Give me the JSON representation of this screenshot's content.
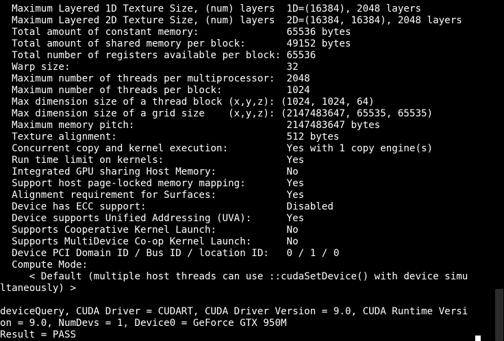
{
  "terminal": {
    "lines": [
      "  Maximum Layered 1D Texture Size, (num) layers  1D=(16384), 2048 layers",
      "  Maximum Layered 2D Texture Size, (num) layers  2D=(16384, 16384), 2048 layers",
      "  Total amount of constant memory:               65536 bytes",
      "  Total amount of shared memory per block:       49152 bytes",
      "  Total number of registers available per block: 65536",
      "  Warp size:                                     32",
      "  Maximum number of threads per multiprocessor:  2048",
      "  Maximum number of threads per block:           1024",
      "  Max dimension size of a thread block (x,y,z): (1024, 1024, 64)",
      "  Max dimension size of a grid size    (x,y,z): (2147483647, 65535, 65535)",
      "  Maximum memory pitch:                          2147483647 bytes",
      "  Texture alignment:                             512 bytes",
      "  Concurrent copy and kernel execution:          Yes with 1 copy engine(s)",
      "  Run time limit on kernels:                     Yes",
      "  Integrated GPU sharing Host Memory:            No",
      "  Support host page-locked memory mapping:       Yes",
      "  Alignment requirement for Surfaces:            Yes",
      "  Device has ECC support:                        Disabled",
      "  Device supports Unified Addressing (UVA):      Yes",
      "  Supports Cooperative Kernel Launch:            No",
      "  Supports MultiDevice Co-op Kernel Launch:      No",
      "  Device PCI Domain ID / Bus ID / location ID:   0 / 1 / 0",
      "  Compute Mode:",
      "     < Default (multiple host threads can use ::cudaSetDevice() with device simu",
      "ltaneously) >",
      "",
      "deviceQuery, CUDA Driver = CUDART, CUDA Driver Version = 9.0, CUDA Runtime Versi",
      "on = 9.0, NumDevs = 1, Device0 = GeForce GTX 950M",
      "Result = PASS"
    ]
  },
  "colors": {
    "background": "#000000",
    "foreground": "#ffffff",
    "scrollbar_thumb": "#2b2b2b"
  }
}
